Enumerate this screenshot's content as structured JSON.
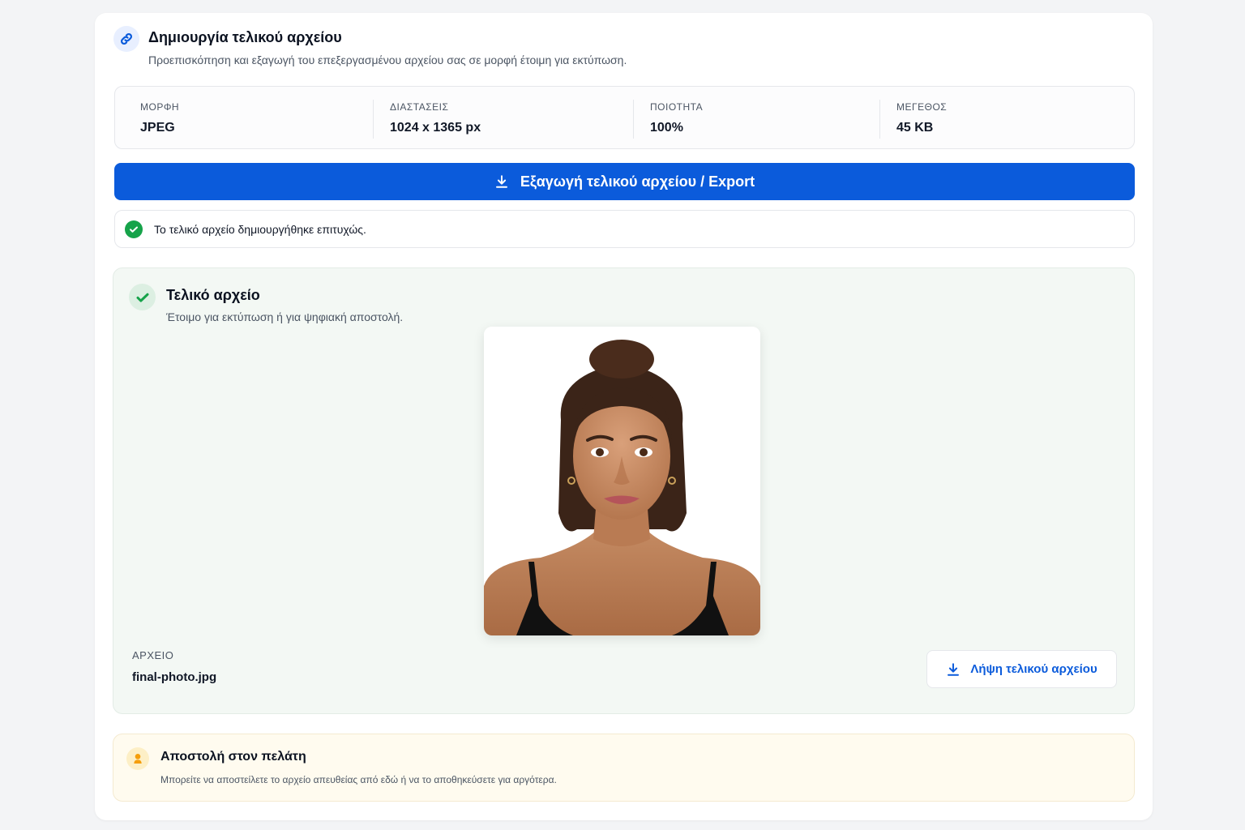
{
  "header": {
    "title": "Δημιουργία τελικού αρχείου",
    "subtitle": "Προεπισκόπηση και εξαγωγή του επεξεργασμένου αρχείου σας σε μορφή έτοιμη για εκτύπωση.",
    "icon": "link-icon"
  },
  "stats": [
    {
      "label": "ΜΟΡΦΗ",
      "value": "JPEG"
    },
    {
      "label": "ΔΙΑΣΤΑΣΕΙΣ",
      "value": "1024 x 1365 px"
    },
    {
      "label": "ΠΟΙΟΤΗΤΑ",
      "value": "100%"
    },
    {
      "label": "ΜΕΓΕΘΟΣ",
      "value": "45 KB"
    }
  ],
  "export_button": {
    "label": "Εξαγωγή τελικού αρχείου / Export",
    "icon": "download-icon"
  },
  "success_message": {
    "text": "Το τελικό αρχείο δημιουργήθηκε επιτυχώς.",
    "icon": "check-circle-icon"
  },
  "final_file": {
    "title": "Τελικό αρχείο",
    "subtitle": "Έτοιμο για εκτύπωση ή για ψηφιακή αποστολή.",
    "file_label": "ΑΡΧΕΙΟ",
    "file_name": "final-photo.jpg",
    "download_label": "Λήψη τελικού αρχείου",
    "icon": "check-badge-icon"
  },
  "send": {
    "title": "Αποστολή στον πελάτη",
    "subtitle": "Μπορείτε να αποστείλετε το αρχείο απευθείας από εδώ ή να το αποθηκεύσετε για αργότερα.",
    "icon": "user-badge-icon"
  },
  "colors": {
    "primary": "#0b5bdb",
    "success": "#16a34a",
    "warning": "#f59e0b"
  }
}
